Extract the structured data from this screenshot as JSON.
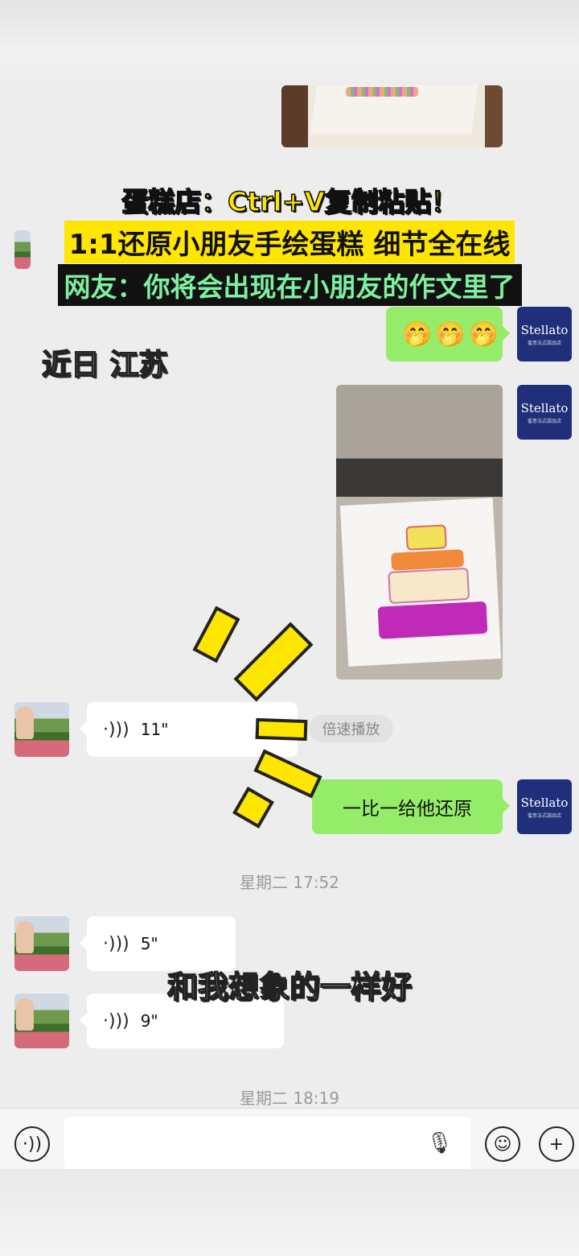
{
  "title_lines": {
    "line1": "蛋糕店：Ctrl+V复制粘贴！",
    "line2": "1:1还原小朋友手绘蛋糕 细节全在线",
    "line3": "网友：你将会出现在小朋友的作文里了"
  },
  "location_caption": "近日 江苏",
  "subtitle": "和我想象的一样好",
  "shop": {
    "brand": "Stellato",
    "sub": "蜜意法式甜品店"
  },
  "messages": {
    "emoji_text": "🤭🤭🤭",
    "voice1_duration": "11\"",
    "speed_play_label": "倍速播放",
    "reply_text": "一比一给他还原",
    "voice2_duration": "5\"",
    "voice3_duration": "9\""
  },
  "timestamps": {
    "t1": "星期二 17:52",
    "t2": "星期二 18:19"
  },
  "icons": {
    "voice_wave": "voice-wave-icon",
    "input_voice": "voice-mode-icon",
    "mic": "microphone-icon",
    "emoji": "emoji-icon",
    "plus": "plus-icon"
  },
  "colors": {
    "green_bubble": "#95ec69",
    "brand_navy": "#1f2f7a",
    "title_yellow": "#ffe600"
  }
}
